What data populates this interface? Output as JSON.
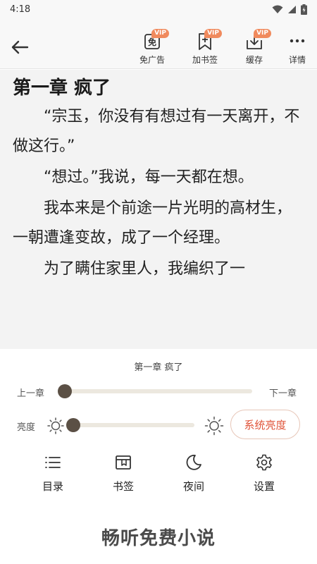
{
  "status_bar": {
    "time": "4:18"
  },
  "toolbar": {
    "ad_free_label": "免广告",
    "ad_free_icon_char": "免",
    "bookmark_label": "加书签",
    "cache_label": "缓存",
    "details_label": "详情",
    "vip_badge": "VIP"
  },
  "content": {
    "chapter_title": "第一章 疯了",
    "paragraphs": [
      "“宗玉，你没有有想过有一天离开，不做这行。”",
      "“想过。”我说，每一天都在想。",
      "我本来是个前途一片光明的高材生，一朝遭逢变故，成了一个经理。",
      "为了瞒住家里人，我编织了一"
    ]
  },
  "panel": {
    "chapter_name": "第一章 疯了",
    "prev_chapter": "上一章",
    "next_chapter": "下一章",
    "progress": 0.0,
    "brightness_label": "亮度",
    "brightness": 0.0,
    "system_brightness": "系统亮度",
    "nav": {
      "toc": "目录",
      "bookmarks": "书签",
      "night": "夜间",
      "settings": "设置"
    },
    "brand": "畅听免费小说"
  },
  "colors": {
    "accent": "#e0543a",
    "thumb": "#5b5045",
    "track": "#ece8df",
    "vip": "#f08a5d"
  }
}
